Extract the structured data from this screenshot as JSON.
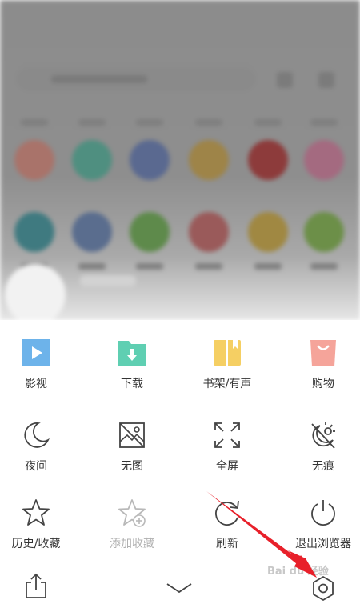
{
  "menu": {
    "row1": [
      {
        "label": "影视",
        "icon": "video-play-icon",
        "color": "#6db3ea"
      },
      {
        "label": "下载",
        "icon": "download-folder-icon",
        "color": "#5fcfb2"
      },
      {
        "label": "书架/有声",
        "icon": "bookshelf-icon",
        "color": "#f5cf63"
      },
      {
        "label": "购物",
        "icon": "shopping-bag-icon",
        "color": "#f5a49a"
      }
    ],
    "row2": [
      {
        "label": "夜间",
        "icon": "moon-icon"
      },
      {
        "label": "无图",
        "icon": "no-image-icon"
      },
      {
        "label": "全屏",
        "icon": "fullscreen-icon"
      },
      {
        "label": "无痕",
        "icon": "incognito-icon"
      }
    ],
    "row3": [
      {
        "label": "历史/收藏",
        "icon": "star-icon",
        "disabled": false
      },
      {
        "label": "添加收藏",
        "icon": "star-add-icon",
        "disabled": true
      },
      {
        "label": "刷新",
        "icon": "refresh-icon",
        "disabled": false
      },
      {
        "label": "退出浏览器",
        "icon": "power-icon",
        "disabled": false
      }
    ]
  },
  "bottom_bar": {
    "share": "share-icon",
    "collapse": "chevron-down-icon",
    "settings": "settings-gear-icon"
  },
  "watermark": "Bai du 经验",
  "colors": {
    "text": "#333333",
    "disabled": "#b0b0b0",
    "icon": "#444444",
    "arrow": "#e8202a"
  }
}
